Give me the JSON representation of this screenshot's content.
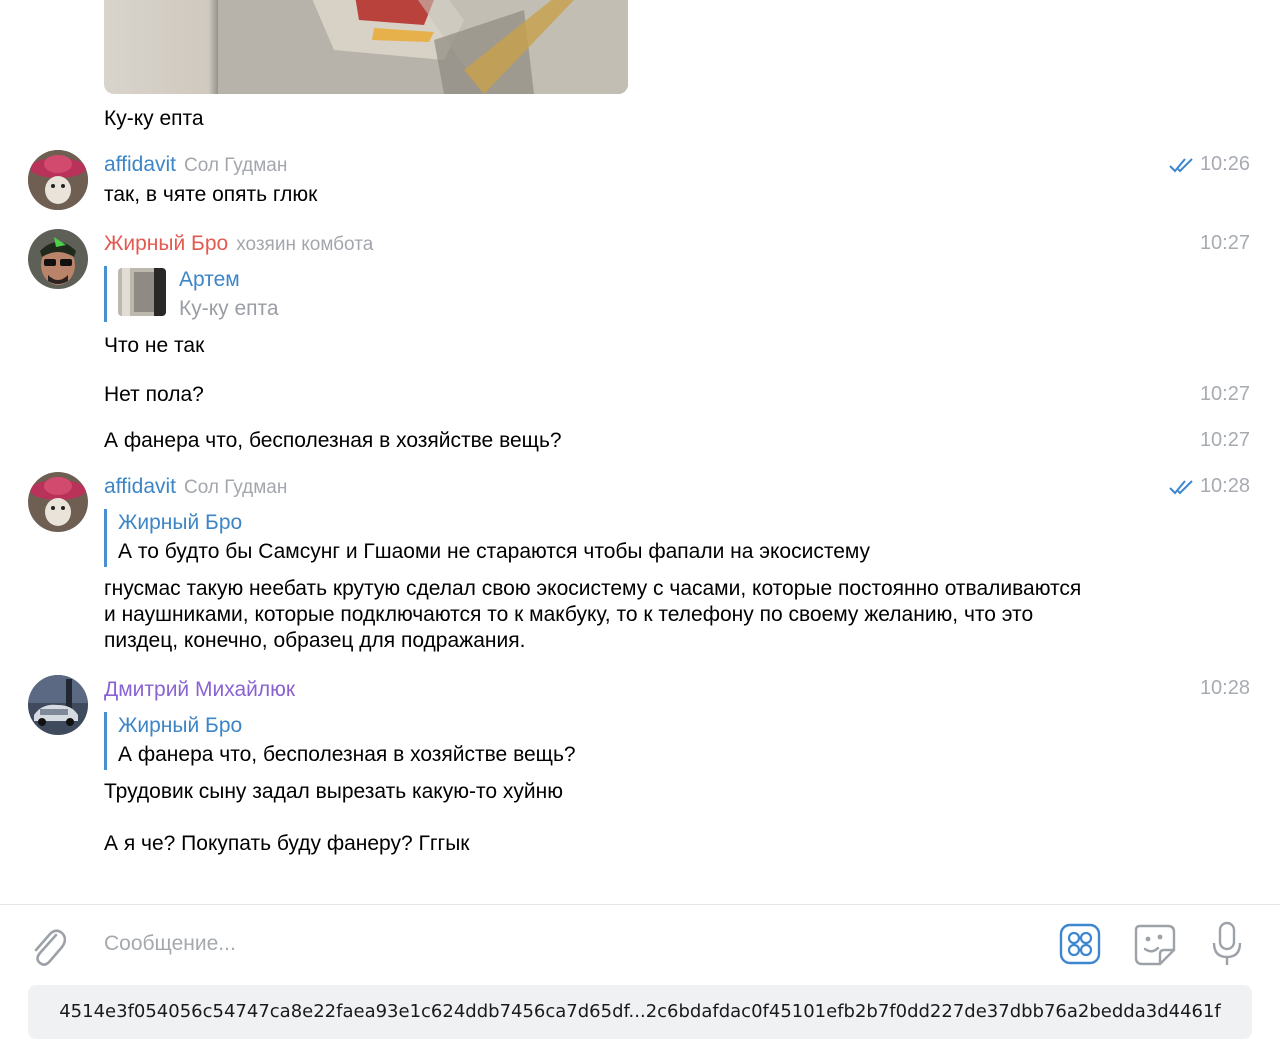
{
  "colors": {
    "sender_blue": "#3d85c6",
    "sender_red": "#e35a50",
    "sender_purple": "#8a63d2",
    "time_grey": "#a7abb2",
    "reply_bar": "#4a8fd1",
    "icon_grey": "#9da2a8",
    "icon_blue": "#3d86d0"
  },
  "messages": {
    "m0": {
      "text": "Ку-ку епта"
    },
    "m1": {
      "sender": "affidavit",
      "role": "Сол Гудман",
      "time": "10:26",
      "text": "так, в чяте опять глюк",
      "read": true
    },
    "m2": {
      "sender": "Жирный Бро",
      "role": "хозяин комбота",
      "time": "10:27",
      "reply": {
        "name": "Артем",
        "text": "Ку-ку епта"
      },
      "text": "Что не так"
    },
    "m3": {
      "time": "10:27",
      "text": "Нет пола?"
    },
    "m4": {
      "time": "10:27",
      "text": "А фанера что, бесполезная в хозяйстве вещь?"
    },
    "m5": {
      "sender": "affidavit",
      "role": "Сол Гудман",
      "time": "10:28",
      "read": true,
      "reply": {
        "name": "Жирный Бро",
        "text": "А то будто бы Самсунг и Гшаоми не стараются чтобы фапали на экосистему"
      },
      "lines": [
        "гнусмас такую неебать крутую сделал свою экосистему с часами, которые постоянно отваливаются",
        "и наушниками, которые подключаются то к макбуку, то к телефону по своему желанию, что это",
        "пиздец, конечно, образец для подражания."
      ]
    },
    "m6": {
      "sender": "Дмитрий Михайлюк",
      "time": "10:28",
      "reply": {
        "name": "Жирный Бро",
        "text": "А фанера что, бесполезная в хозяйстве вещь?"
      },
      "text": "Трудовик сыну задал вырезать какую-то хуйню"
    },
    "m7": {
      "text": "А я че? Покупать буду фанеру? Гггык"
    }
  },
  "composer": {
    "placeholder": "Сообщение...",
    "icons": [
      "paperclip-icon",
      "bot-commands-icon",
      "sticker-icon",
      "microphone-icon"
    ]
  },
  "hash_text": "4514e3f054056c54747ca8e22faea93e1c624ddb7456ca7d65df...2c6bdafdac0f45101efb2b7f0dd227de37dbb76a2bedda3d4461f"
}
